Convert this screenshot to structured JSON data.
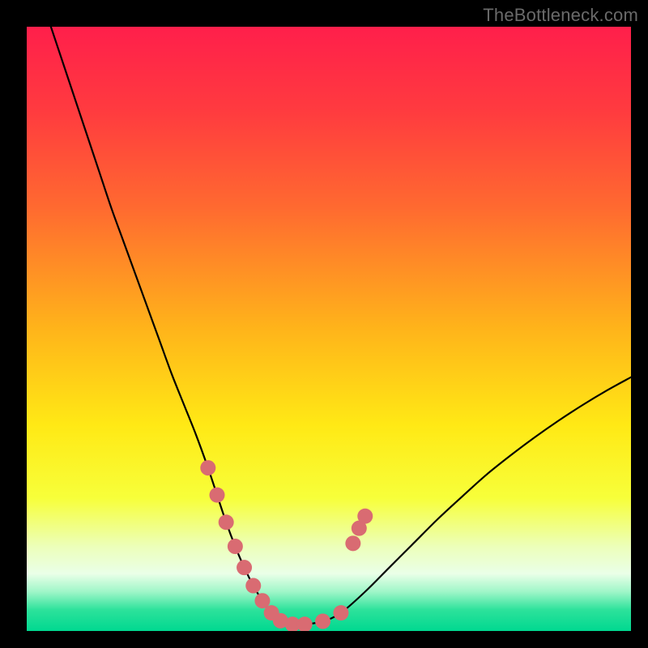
{
  "watermark": "TheBottleneck.com",
  "colors": {
    "frame": "#000000",
    "curve": "#000000",
    "marker": "#d96b72",
    "marker_alt": "#ce6a6d",
    "gradient_stops": [
      {
        "offset": 0.0,
        "color": "#ff1f4b"
      },
      {
        "offset": 0.14,
        "color": "#ff3b3f"
      },
      {
        "offset": 0.3,
        "color": "#ff6a30"
      },
      {
        "offset": 0.5,
        "color": "#ffb41a"
      },
      {
        "offset": 0.66,
        "color": "#ffe915"
      },
      {
        "offset": 0.78,
        "color": "#f7ff3a"
      },
      {
        "offset": 0.86,
        "color": "#ecffb9"
      },
      {
        "offset": 0.905,
        "color": "#eaffe8"
      },
      {
        "offset": 0.935,
        "color": "#9ff6c8"
      },
      {
        "offset": 0.965,
        "color": "#2de29b"
      },
      {
        "offset": 1.0,
        "color": "#00d890"
      }
    ]
  },
  "chart_data": {
    "type": "line",
    "title": "",
    "xlabel": "",
    "ylabel": "",
    "xlim": [
      0,
      100
    ],
    "ylim": [
      0,
      100
    ],
    "series": [
      {
        "name": "bottleneck-curve",
        "x": [
          4,
          6,
          8,
          10,
          12,
          14,
          16,
          18,
          20,
          22,
          24,
          26,
          28,
          30,
          31.5,
          33,
          34.5,
          36,
          37.5,
          39,
          40.5,
          42,
          44,
          46,
          49,
          52,
          56,
          60,
          64,
          68,
          72,
          76,
          80,
          84,
          88,
          92,
          96,
          100
        ],
        "y": [
          100,
          94,
          88,
          82,
          76,
          70,
          64.5,
          59,
          53.5,
          48,
          42.5,
          37.5,
          32.5,
          27,
          22.5,
          18,
          14,
          10.5,
          7.5,
          5,
          3,
          1.7,
          1.1,
          1.1,
          1.6,
          3,
          6.5,
          10.5,
          14.5,
          18.5,
          22.2,
          25.8,
          29,
          32,
          34.8,
          37.4,
          39.8,
          42
        ]
      }
    ],
    "markers": {
      "name": "highlight-points",
      "points": [
        {
          "x": 30.0,
          "y": 27.0
        },
        {
          "x": 31.5,
          "y": 22.5
        },
        {
          "x": 33.0,
          "y": 18.0
        },
        {
          "x": 34.5,
          "y": 14.0
        },
        {
          "x": 36.0,
          "y": 10.5
        },
        {
          "x": 37.5,
          "y": 7.5
        },
        {
          "x": 39.0,
          "y": 5.0
        },
        {
          "x": 40.5,
          "y": 3.0
        },
        {
          "x": 42.0,
          "y": 1.7
        },
        {
          "x": 44.0,
          "y": 1.1
        },
        {
          "x": 46.0,
          "y": 1.1
        },
        {
          "x": 49.0,
          "y": 1.6
        },
        {
          "x": 52.0,
          "y": 3.0
        },
        {
          "x": 54.0,
          "y": 14.5
        },
        {
          "x": 55.0,
          "y": 17.0
        },
        {
          "x": 56.0,
          "y": 19.0
        }
      ]
    }
  }
}
